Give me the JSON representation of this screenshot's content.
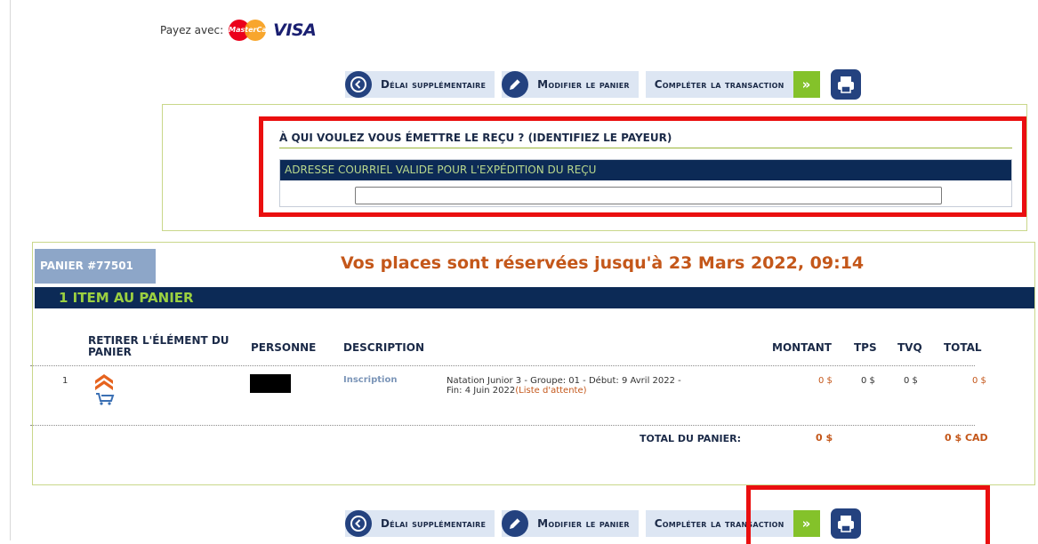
{
  "payment": {
    "label": "Payez avec:",
    "mastercard_text": "MasterCard",
    "visa_text": "VISA"
  },
  "actions": {
    "delay_label": "Délai supplémentaire",
    "modify_label": "Modifier le panier",
    "complete_label": "Compléter la transaction",
    "go_symbol": "»"
  },
  "receipt": {
    "title": "À QUI VOULEZ VOUS ÉMETTRE LE REÇU ? (IDENTIFIEZ LE PAYEUR)",
    "email_header": "ADRESSE COURRIEL VALIDE POUR L'EXPÉDITION DU REÇU",
    "email_value": ""
  },
  "cart": {
    "number_label": "PANIER #77501",
    "reserved_text": "Vos places sont réservées jusqu'à 23 Mars 2022, 09:14",
    "items_bar": "1  ITEM AU PANIER",
    "columns": {
      "remove": "RETIRER L'ÉLÉMENT DU PANIER",
      "person": "PERSONNE",
      "description": "DESCRIPTION",
      "amount": "MONTANT",
      "tps": "TPS",
      "tvq": "TVQ",
      "total": "TOTAL"
    },
    "rows": [
      {
        "index": "1",
        "type": "Inscription",
        "description_line1": "Natation Junior 3  - Groupe: 01  - Début: 9 Avril 2022  -",
        "description_line2": "Fin: 4 Juin 2022",
        "waitlist": "(Liste d'attente)",
        "amount": "0 $",
        "tps": "0 $",
        "tvq": "0 $",
        "total": "0 $"
      }
    ],
    "total_label": "TOTAL DU PANIER:",
    "total_amount": "0 $",
    "total_cad": "0 $ CAD"
  },
  "colors": {
    "navy": "#0c2a56",
    "accent_green": "#84c22a",
    "orange": "#c4571a",
    "highlight_red": "#ea0f0f"
  }
}
